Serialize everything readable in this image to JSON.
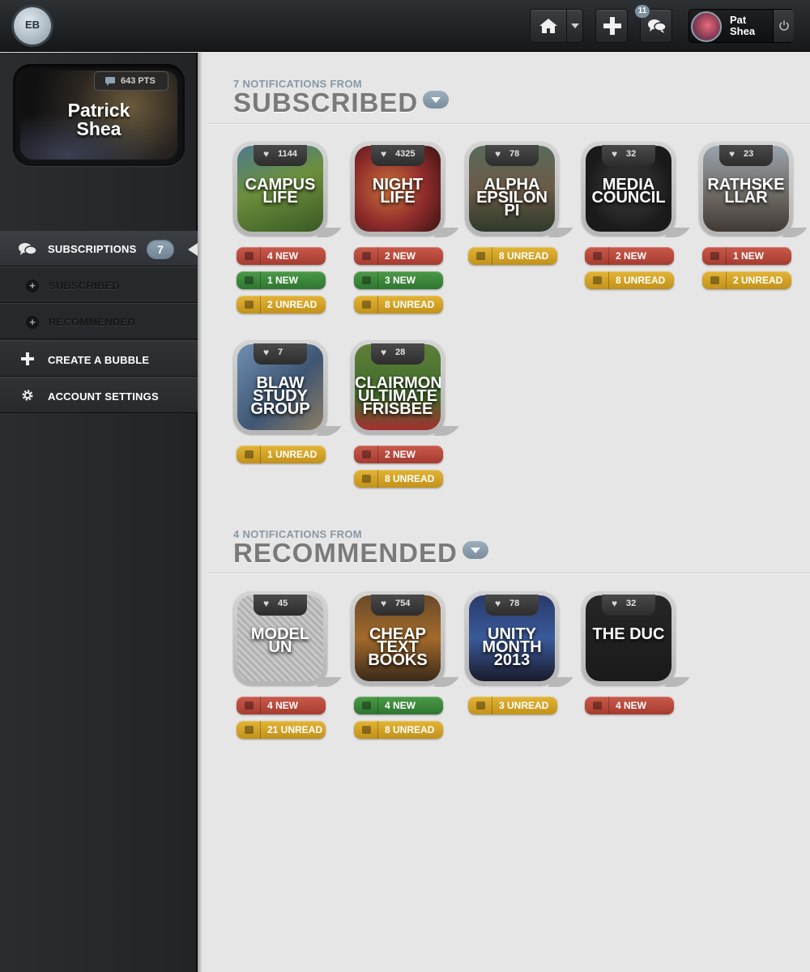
{
  "app": {
    "logo_text": "EB",
    "notification_count": "11"
  },
  "user": {
    "name_line1": "Pat",
    "name_line2": "Shea"
  },
  "profile": {
    "name_line1": "Patrick",
    "name_line2": "Shea",
    "points": "643 PTS"
  },
  "nav": {
    "subscriptions_label": "SUBSCRIPTIONS",
    "subscriptions_count": "7",
    "subscribed_label": "SUBSCRIBED",
    "recommended_label": "RECOMMENDED",
    "create_label": "CREATE A BUBBLE",
    "account_label": "ACCOUNT SETTINGS"
  },
  "colors": {
    "new": "#b84838",
    "tag": "#3c8a3b",
    "unread": "#d4a42a",
    "accent": "#7d8f9e"
  },
  "subscribed": {
    "notifications": "7 NOTIFICATIONS FROM",
    "title": "SUBSCRIBED",
    "bubbles": [
      {
        "title": "CAMPUS LIFE",
        "likes": "1144",
        "pills": [
          {
            "type": "new",
            "label": "4 NEW"
          },
          {
            "type": "tag",
            "label": "1 NEW"
          },
          {
            "type": "unread",
            "label": "2 UNREAD"
          }
        ]
      },
      {
        "title": "NIGHT LIFE",
        "likes": "4325",
        "pills": [
          {
            "type": "new",
            "label": "2 NEW"
          },
          {
            "type": "tag",
            "label": "3 NEW"
          },
          {
            "type": "unread",
            "label": "8 UNREAD"
          }
        ]
      },
      {
        "title": "ALPHA EPSILON PI",
        "likes": "78",
        "pills": [
          {
            "type": "unread",
            "label": "8 UNREAD"
          }
        ]
      },
      {
        "title": "MEDIA COUNCIL",
        "likes": "32",
        "pills": [
          {
            "type": "new",
            "label": "2 NEW"
          },
          {
            "type": "unread",
            "label": "8 UNREAD"
          }
        ]
      },
      {
        "title": "RATHSKE LLAR",
        "likes": "23",
        "pills": [
          {
            "type": "new",
            "label": "1 NEW"
          },
          {
            "type": "unread",
            "label": "2 UNREAD"
          }
        ]
      },
      {
        "title": "BLAW STUDY GROUP",
        "likes": "7",
        "pills": [
          {
            "type": "unread",
            "label": "1 UNREAD"
          }
        ]
      },
      {
        "title": "CLAIRMONT ULTIMATE FRISBEE",
        "likes": "28",
        "pills": [
          {
            "type": "new",
            "label": "2 NEW"
          },
          {
            "type": "unread",
            "label": "8 UNREAD"
          }
        ]
      }
    ]
  },
  "recommended": {
    "notifications": "4 NOTIFICATIONS FROM",
    "title": "RECOMMENDED",
    "bubbles": [
      {
        "title": "MODEL UN",
        "likes": "45",
        "pills": [
          {
            "type": "new",
            "label": "4 NEW"
          },
          {
            "type": "unread",
            "label": "21 UNREAD"
          }
        ]
      },
      {
        "title": "CHEAP TEXT BOOKS",
        "likes": "754",
        "pills": [
          {
            "type": "tag",
            "label": "4 NEW"
          },
          {
            "type": "unread",
            "label": "8 UNREAD"
          }
        ]
      },
      {
        "title": "UNITY MONTH 2013",
        "likes": "78",
        "pills": [
          {
            "type": "unread",
            "label": "3 UNREAD"
          }
        ]
      },
      {
        "title": "THE DUC",
        "likes": "32",
        "pills": [
          {
            "type": "new",
            "label": "4 NEW"
          }
        ]
      }
    ]
  }
}
